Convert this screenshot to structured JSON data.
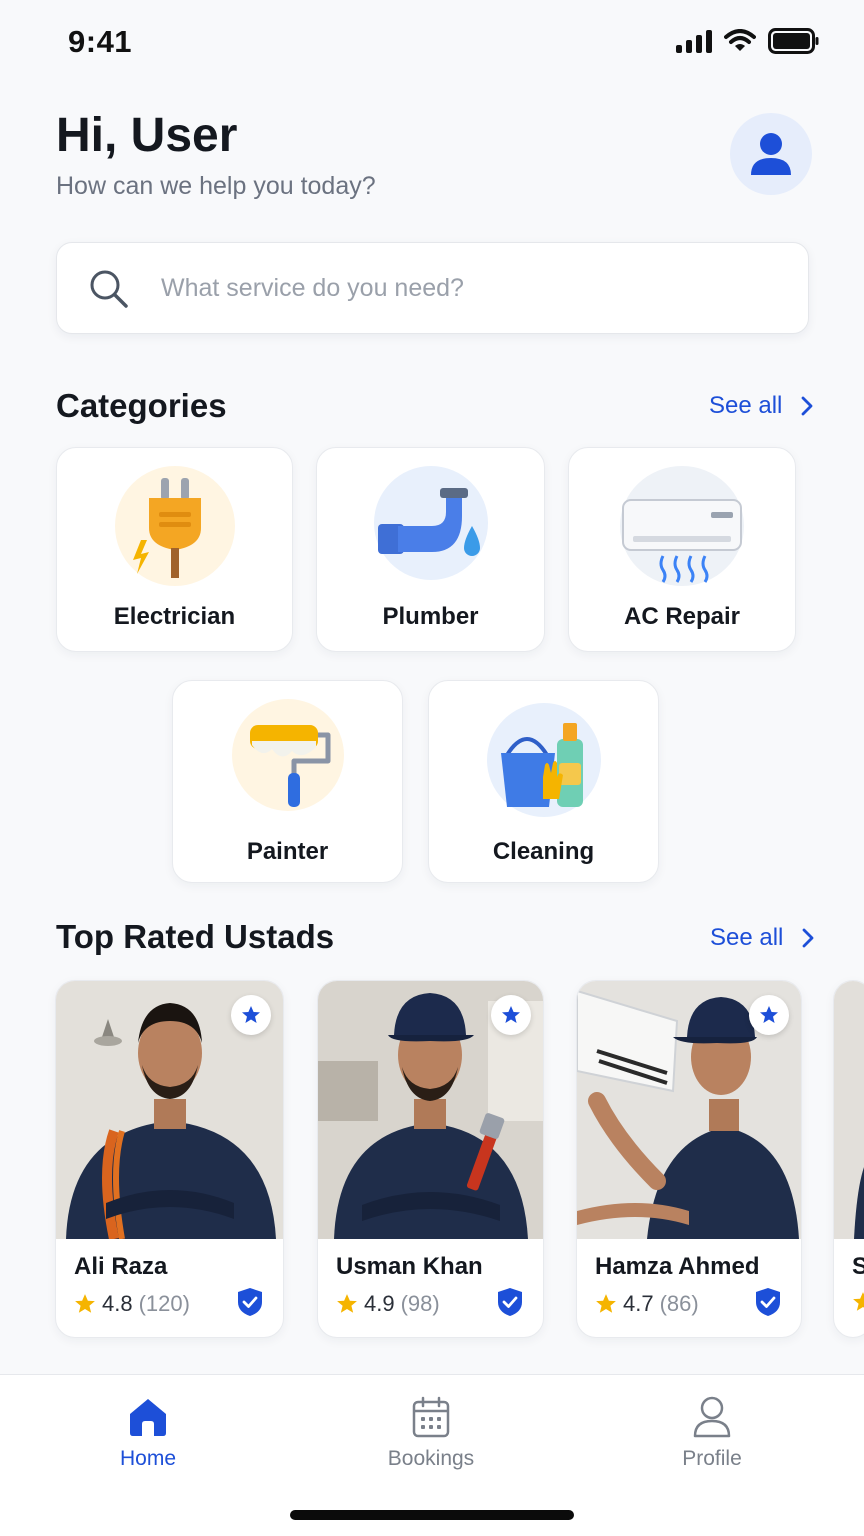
{
  "status_bar": {
    "time": "9:41"
  },
  "header": {
    "greeting": "Hi, User",
    "subtitle": "How can we help you today?"
  },
  "search": {
    "placeholder": "What service do you need?"
  },
  "categories": {
    "title": "Categories",
    "see_all": "See all",
    "items": [
      {
        "label": "Electrician",
        "icon": "plug-icon"
      },
      {
        "label": "Plumber",
        "icon": "pipe-icon"
      },
      {
        "label": "AC Repair",
        "icon": "air-conditioner-icon"
      },
      {
        "label": "Painter",
        "icon": "paint-roller-icon"
      },
      {
        "label": "Cleaning",
        "icon": "cleaning-bucket-icon"
      }
    ]
  },
  "top_rated": {
    "title": "Top Rated Ustads",
    "see_all": "See all",
    "ustads": [
      {
        "name": "Ali Raza",
        "rating": "4.8",
        "reviews": "(120)"
      },
      {
        "name": "Usman Khan",
        "rating": "4.9",
        "reviews": "(98)"
      },
      {
        "name": "Hamza Ahmed",
        "rating": "4.7",
        "reviews": "(86)"
      },
      {
        "name": "S",
        "rating": "",
        "reviews": ""
      }
    ]
  },
  "bottom_nav": {
    "items": [
      {
        "label": "Home",
        "icon": "home-icon",
        "active": true
      },
      {
        "label": "Bookings",
        "icon": "calendar-icon",
        "active": false
      },
      {
        "label": "Profile",
        "icon": "user-icon",
        "active": false
      }
    ]
  },
  "colors": {
    "accent": "#1d4fd8",
    "star": "#f5b400",
    "background": "#f8f9fb",
    "text": "#14181f",
    "muted": "#6b7280"
  }
}
